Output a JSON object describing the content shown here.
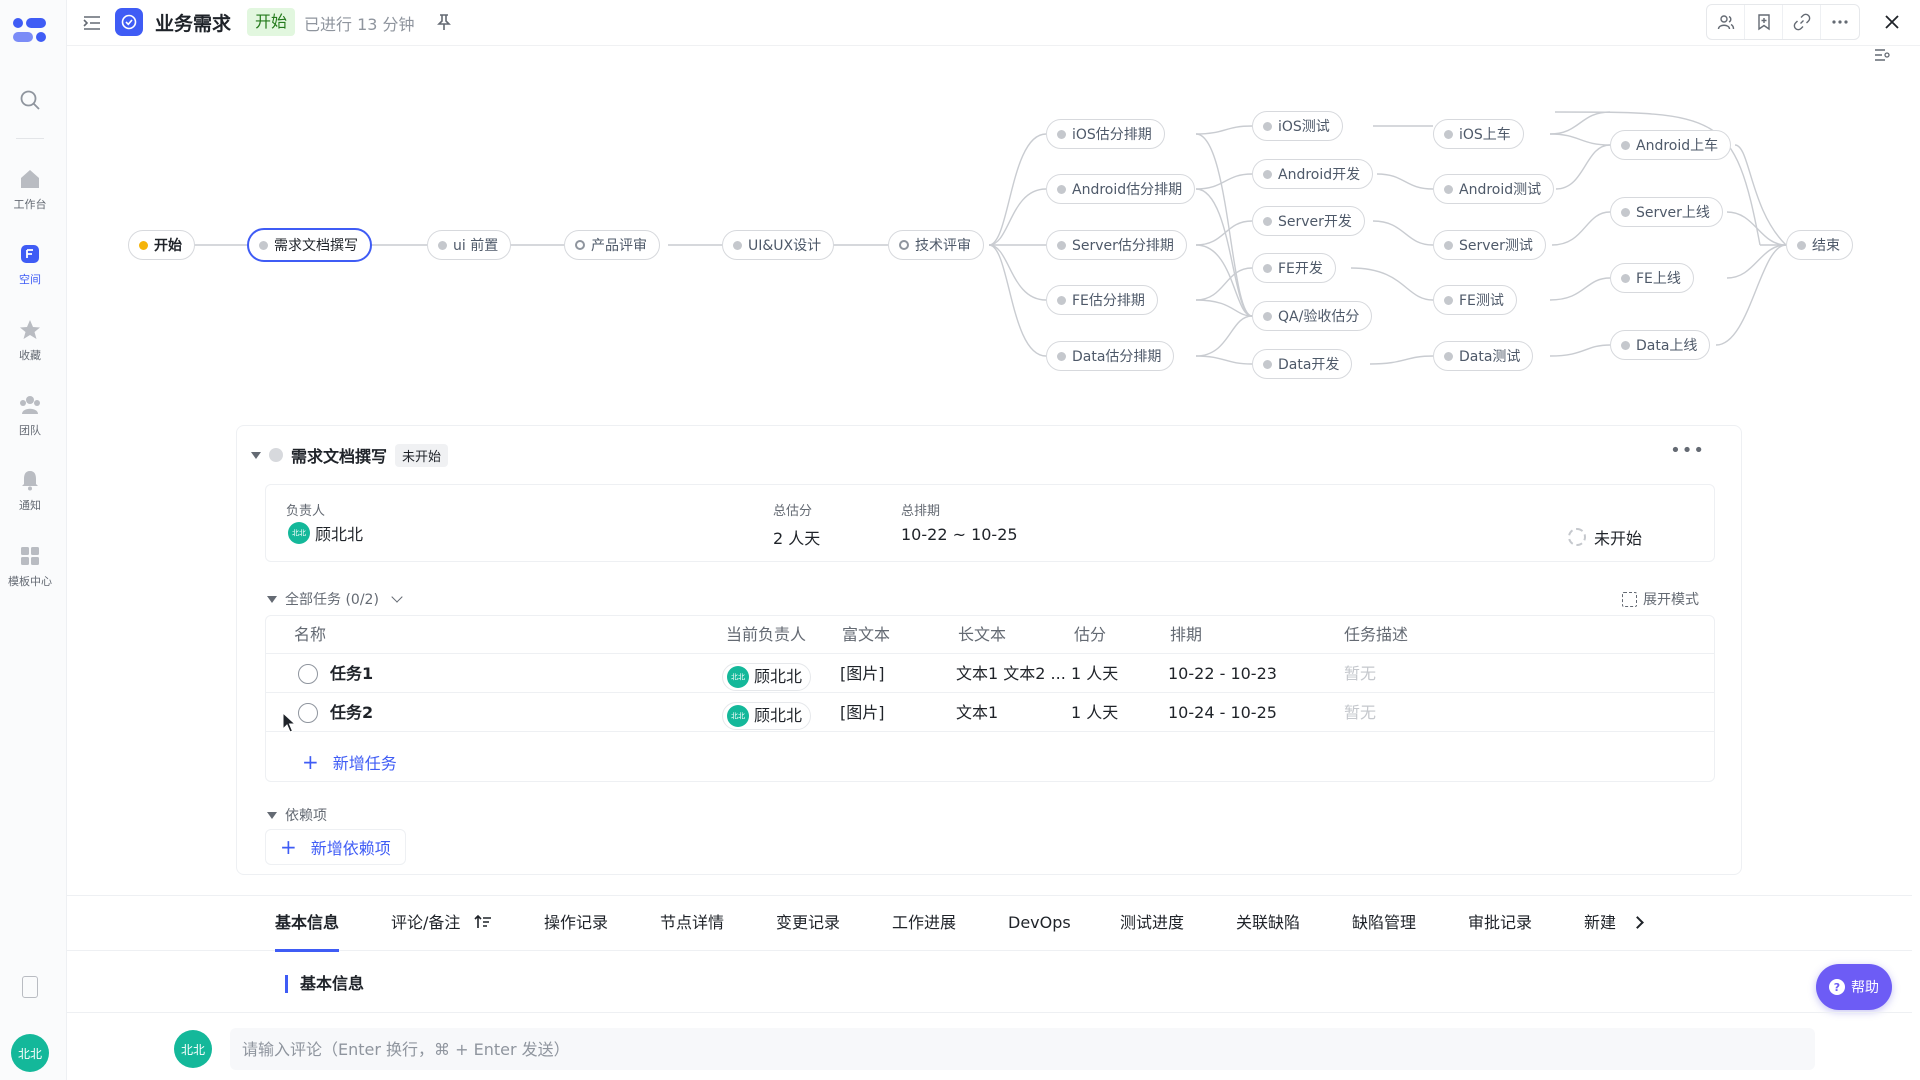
{
  "topbar": {
    "title": "业务需求",
    "status": "开始",
    "elapsed": "已进行 13 分钟",
    "right_icons": [
      "members-icon",
      "bookmark-icon",
      "link-icon",
      "more-icon"
    ]
  },
  "sidebar": {
    "items": [
      {
        "label": "工作台",
        "icon": "home-icon"
      },
      {
        "label": "空间",
        "icon": "space-icon",
        "active": true
      },
      {
        "label": "收藏",
        "icon": "star-icon"
      },
      {
        "label": "团队",
        "icon": "team-icon"
      },
      {
        "label": "通知",
        "icon": "bell-icon"
      },
      {
        "label": "模板中心",
        "icon": "template-icon"
      }
    ],
    "user": "北北"
  },
  "flow": {
    "nodes": {
      "start": "开始",
      "req_doc": "需求文档撰写",
      "ui_pre": "ui 前置",
      "prod_review": "产品评审",
      "uiux": "UI&UX设计",
      "tech_review": "技术评审",
      "ios_est": "iOS估分排期",
      "android_est": "Android估分排期",
      "server_est": "Server估分排期",
      "fe_est": "FE估分排期",
      "data_est": "Data估分排期",
      "ios_test": "iOS测试",
      "android_dev": "Android开发",
      "server_dev": "Server开发",
      "fe_dev": "FE开发",
      "qa_est": "QA/验收估分",
      "data_dev": "Data开发",
      "ios_launch": "iOS上车",
      "android_test": "Android测试",
      "server_test": "Server测试",
      "fe_test": "FE测试",
      "data_test": "Data测试",
      "android_launch": "Android上车",
      "server_launch": "Server上线",
      "fe_launch": "FE上线",
      "data_launch": "Data上线",
      "end": "结束"
    }
  },
  "node_card": {
    "title": "需求文档撰写",
    "tag": "未开始",
    "info": {
      "owner_label": "负责人",
      "owner_name": "顾北北",
      "owner_avatar": "北北",
      "estimate_label": "总估分",
      "estimate_value": "2 人天",
      "schedule_label": "总排期",
      "schedule_value": "10-22 ~ 10-25",
      "status": "未开始"
    },
    "tasks": {
      "header": "全部任务 (0/2)",
      "expand_mode": "展开模式",
      "columns": [
        "名称",
        "当前负责人",
        "富文本",
        "长文本",
        "估分",
        "排期",
        "任务描述"
      ],
      "rows": [
        {
          "name": "任务1",
          "owner": "顾北北",
          "rich": "[图片]",
          "long": "文本1 文本2 ...",
          "estimate": "1 人天",
          "schedule": "10-22  - 10-23",
          "desc": "暂无"
        },
        {
          "name": "任务2",
          "owner": "顾北北",
          "rich": "[图片]",
          "long": "文本1",
          "estimate": "1 人天",
          "schedule": "10-24  - 10-25",
          "desc": "暂无"
        }
      ],
      "add_label": "新增任务"
    },
    "deps": {
      "header": "依赖项",
      "add_label": "新增依赖项"
    }
  },
  "tabs": [
    "基本信息",
    "评论/备注",
    "操作记录",
    "节点详情",
    "变更记录",
    "工作进展",
    "DevOps",
    "测试进度",
    "关联缺陷",
    "缺陷管理",
    "审批记录",
    "新建"
  ],
  "section_title": "基本信息",
  "help_label": "帮助",
  "comment": {
    "avatar": "北北",
    "placeholder": "请输入评论（Enter 换行，⌘ + Enter 发送）"
  },
  "colors": {
    "accent": "#3f5cf5",
    "status_green_bg": "#e2f7df",
    "avatar_green": "#14b89a",
    "help_purple": "#6d5cf5"
  }
}
